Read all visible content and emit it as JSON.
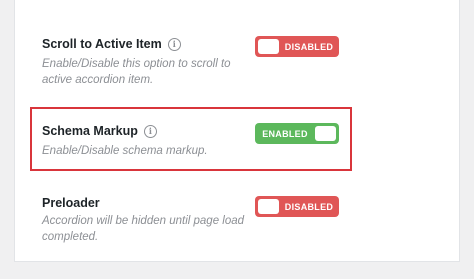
{
  "settings": [
    {
      "label": "Scroll to Active Item",
      "description": "Enable/Disable this option to scroll to active accordion item.",
      "toggle_state": "DISABLED"
    },
    {
      "label": "Schema Markup",
      "description": "Enable/Disable schema markup.",
      "toggle_state": "ENABLED"
    },
    {
      "label": "Preloader",
      "description": "Accordion will be hidden until page load completed.",
      "toggle_state": "DISABLED"
    }
  ],
  "info_icon_glyph": "i",
  "colors": {
    "disabled": "#e05656",
    "enabled": "#5cb85c",
    "highlight": "#d9353b"
  }
}
